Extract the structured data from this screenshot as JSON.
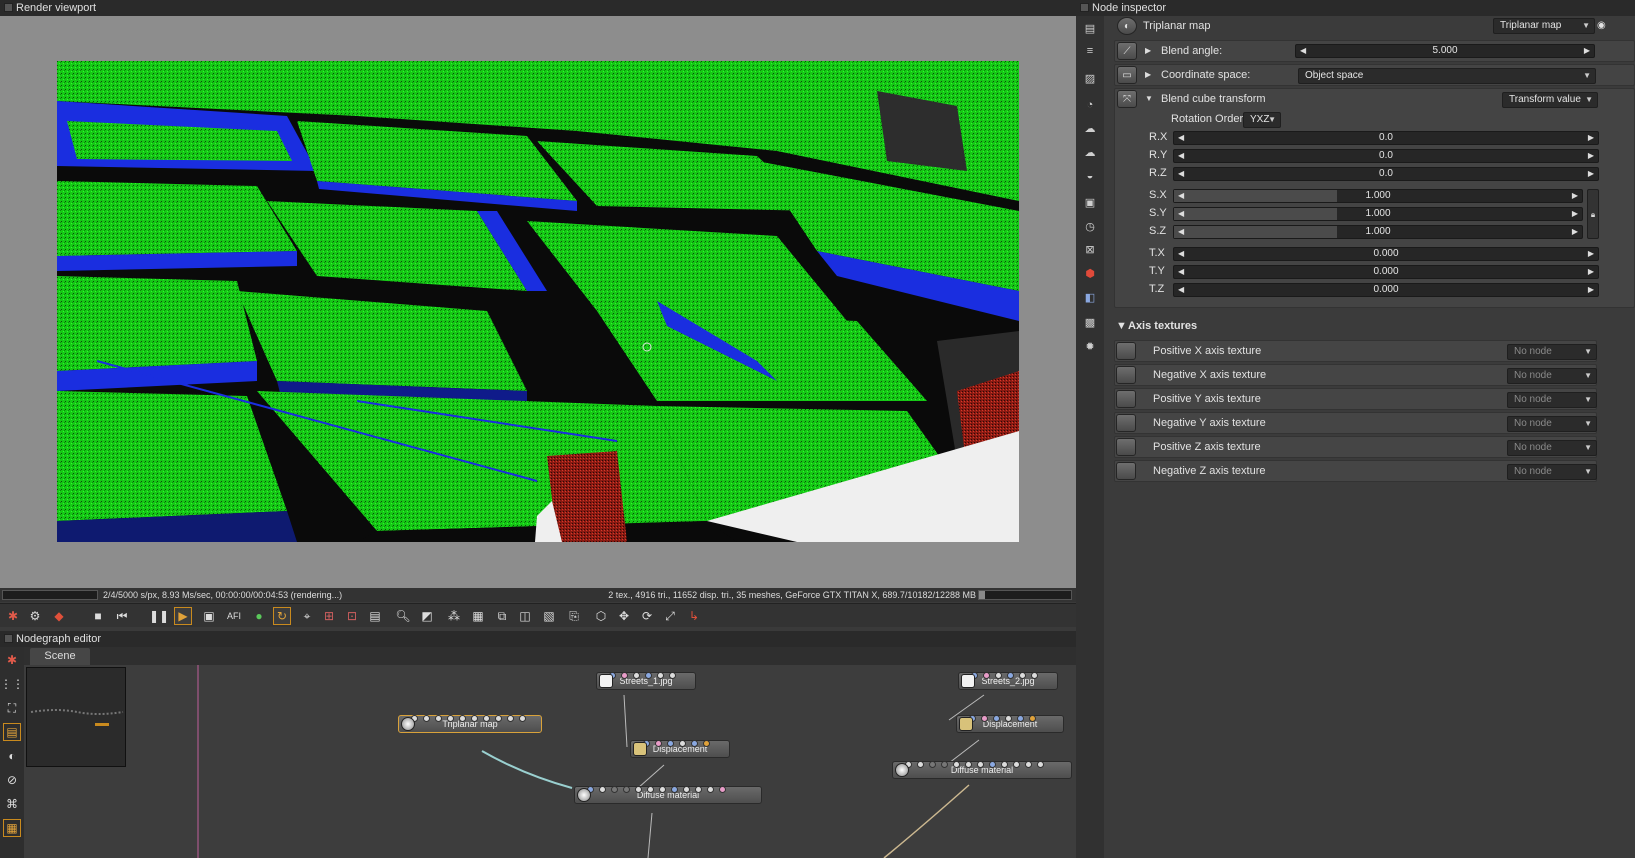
{
  "viewport": {
    "title": "Render viewport",
    "status_left": "2/4/5000 s/px, 8.93 Ms/sec, 00:00:00/00:04:53 (rendering...)",
    "status_right": "2 tex., 4916 tri., 11652 disp. tri., 35 meshes, GeForce GTX TITAN X, 689.7/10182/12288 MB",
    "gpu_memory_fraction": 0.07
  },
  "toolbar": {
    "icons": [
      "octane-logo-icon",
      "settings-icon",
      "color-cube-icon",
      "stop-icon",
      "rewind-icon",
      "pause-icon",
      "play-icon",
      "display-icon",
      "afi-icon",
      "color-wheel-icon",
      "refresh-icon",
      "focus-icon",
      "region-icon",
      "clear-region-icon",
      "film-region-icon",
      "zoom-icon",
      "fit-icon",
      "picker-icon",
      "select-icon",
      "copy-icon",
      "material-icon",
      "lock-icon",
      "object-icon",
      "move-icon",
      "rotate-icon",
      "scale-icon",
      "axis-icon"
    ],
    "afi_label": "AFI"
  },
  "nodegraph": {
    "title": "Nodegraph editor",
    "tab_scene": "Scene",
    "nodes": {
      "streets1": "Streets_1.jpg",
      "triplanar": "Triplanar map",
      "displacement1": "Displacement",
      "diffuse1": "Diffuse material",
      "streets2": "Streets_2.jpg",
      "displacement2": "Displacement",
      "diffuse2": "Diffuse material"
    }
  },
  "inspector": {
    "title": "Node inspector",
    "node_name": "Triplanar map",
    "node_type": "Triplanar map",
    "blend_angle_label": "Blend angle:",
    "blend_angle_value": "5.000",
    "blend_angle_fraction": 0.0,
    "coord_space_label": "Coordinate space:",
    "coord_space_value": "Object space",
    "blend_cube_label": "Blend cube transform",
    "blend_cube_type": "Transform value",
    "rotation_order_label": "Rotation Order",
    "rotation_order_value": "YXZ",
    "rx_label": "R.X",
    "rx_value": "0.0",
    "ry_label": "R.Y",
    "ry_value": "0.0",
    "rz_label": "R.Z",
    "rz_value": "0.0",
    "sx_label": "S.X",
    "sx_value": "1.000",
    "sy_label": "S.Y",
    "sy_value": "1.000",
    "sz_label": "S.Z",
    "sz_value": "1.000",
    "tx_label": "T.X",
    "tx_value": "0.000",
    "ty_label": "T.Y",
    "ty_value": "0.000",
    "tz_label": "T.Z",
    "tz_value": "0.000",
    "axis_textures_label": "Axis textures",
    "textures": [
      {
        "label": "Positive X axis texture",
        "value": "No node"
      },
      {
        "label": "Negative X axis texture",
        "value": "No node"
      },
      {
        "label": "Positive Y axis texture",
        "value": "No node"
      },
      {
        "label": "Negative Y axis texture",
        "value": "No node"
      },
      {
        "label": "Positive Z axis texture",
        "value": "No node"
      },
      {
        "label": "Negative Z axis texture",
        "value": "No node"
      }
    ]
  },
  "colors": {
    "accent": "#c98a1e",
    "render_green": "#1ee81e",
    "render_blue": "#1a2ee0",
    "render_red": "#b0241a"
  }
}
